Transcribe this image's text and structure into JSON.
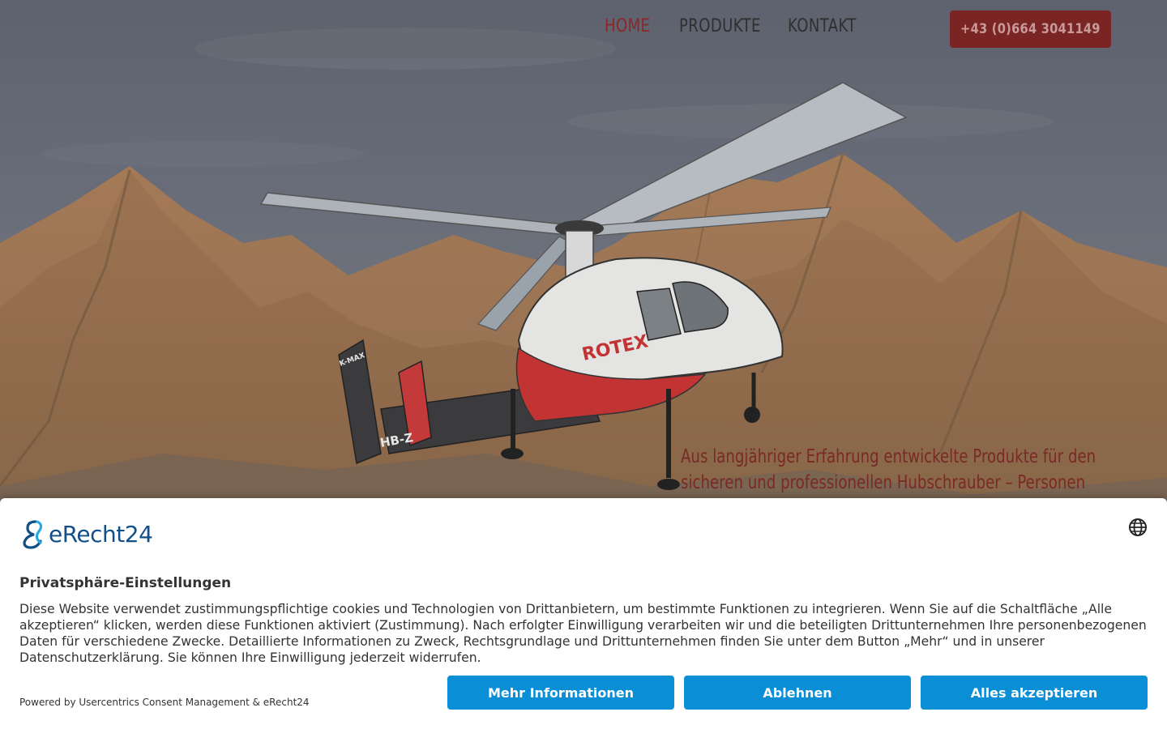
{
  "nav": {
    "links": [
      {
        "label": "HOME",
        "active": true
      },
      {
        "label": "PRODUKTE",
        "active": false
      },
      {
        "label": "KONTAKT",
        "active": false
      }
    ],
    "phone": "+43 (0)664 3041149"
  },
  "hero": {
    "tagline_line1": "Aus langjähriger Erfahrung entwickelte Produkte für den",
    "tagline_line2": "sicheren  und professionellen Hubschrauber – Personen",
    "helicopter_brand": "ROTEX",
    "helicopter_model": "K-MAX",
    "helicopter_reg": "HB-Z"
  },
  "consent": {
    "logo_text": "eRecht24",
    "title": "Privatsphäre-Einstellungen",
    "body": "Diese Website verwendet zustimmungspflichtige cookies und Technologien von Drittanbietern, um bestimmte Funktionen zu integrieren. Wenn Sie auf die Schaltfläche „Alle akzeptieren“ klicken, werden diese Funktionen aktiviert (Zustimmung). Nach erfolgter Einwilligung verarbeiten wir und die beteiligten Drittunternehmen Ihre personenbezogenen Daten für verschiedene Zwecke. Detaillierte Informationen zu Zweck, Rechtsgrundlage und Drittunternehmen finden Sie unter dem Button „Mehr“ und in unserer Datenschutzerklärung. Sie können Ihre Einwilligung jederzeit widerrufen.",
    "powered_by": "Powered by Usercentrics Consent Management & eRecht24",
    "buttons": {
      "more": "Mehr Informationen",
      "deny": "Ablehnen",
      "accept": "Alles akzeptieren"
    }
  },
  "colors": {
    "accent_red": "#7b2424",
    "button_blue": "#0a8fd6",
    "logo_blue": "#124f87"
  },
  "icons": [
    "globe-icon",
    "erecht24-logo-icon"
  ]
}
